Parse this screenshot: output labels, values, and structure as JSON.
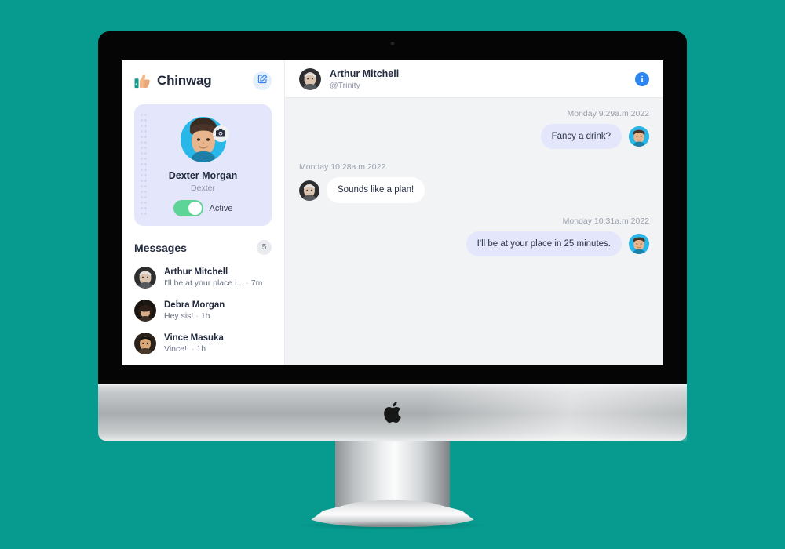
{
  "theme": {
    "page_background": "#079a8e",
    "accent_blue": "#2f86f0",
    "bubble_out": "#e4e6fb",
    "bubble_in": "#ffffff",
    "card_background": "#e4e6fb",
    "toggle_on": "#5fd497"
  },
  "device": {
    "brand_logo": "apple-logo",
    "camera": "webcam-dot"
  },
  "sidebar": {
    "brand": {
      "logo_icon": "thumbs-up-icon",
      "name": "Chinwag",
      "compose_icon": "compose-edit-icon"
    },
    "profile": {
      "avatar": "dexter-avatar",
      "camera_icon": "camera-icon",
      "name": "Dexter Morgan",
      "handle": "Dexter",
      "status_label": "Active",
      "toggle_state": "on"
    },
    "messages": {
      "title": "Messages",
      "count": "5",
      "items": [
        {
          "avatar": "arthur-avatar",
          "name": "Arthur Mitchell",
          "preview": "I'll be at your place i...",
          "separator": "·",
          "time": "7m"
        },
        {
          "avatar": "debra-avatar",
          "name": "Debra Morgan",
          "preview": "Hey sis!",
          "separator": "·",
          "time": "1h"
        },
        {
          "avatar": "vince-avatar",
          "name": "Vince Masuka",
          "preview": "Vince!!",
          "separator": "·",
          "time": "1h"
        }
      ]
    }
  },
  "chat": {
    "header": {
      "avatar": "arthur-avatar",
      "name": "Arthur Mitchell",
      "handle": "@Trinity",
      "info_icon": "info-icon",
      "info_label": "i"
    },
    "messages": [
      {
        "timestamp": "Monday 9:29a.m 2022",
        "text": "Fancy a drink?",
        "direction": "out",
        "avatar": "dexter-avatar"
      },
      {
        "timestamp": "Monday 10:28a.m 2022",
        "text": "Sounds like a plan!",
        "direction": "in",
        "avatar": "arthur-avatar"
      },
      {
        "timestamp": "Monday 10:31a.m 2022",
        "text": "I'll be at your place in 25 minutes.",
        "direction": "out",
        "avatar": "dexter-avatar"
      }
    ]
  }
}
